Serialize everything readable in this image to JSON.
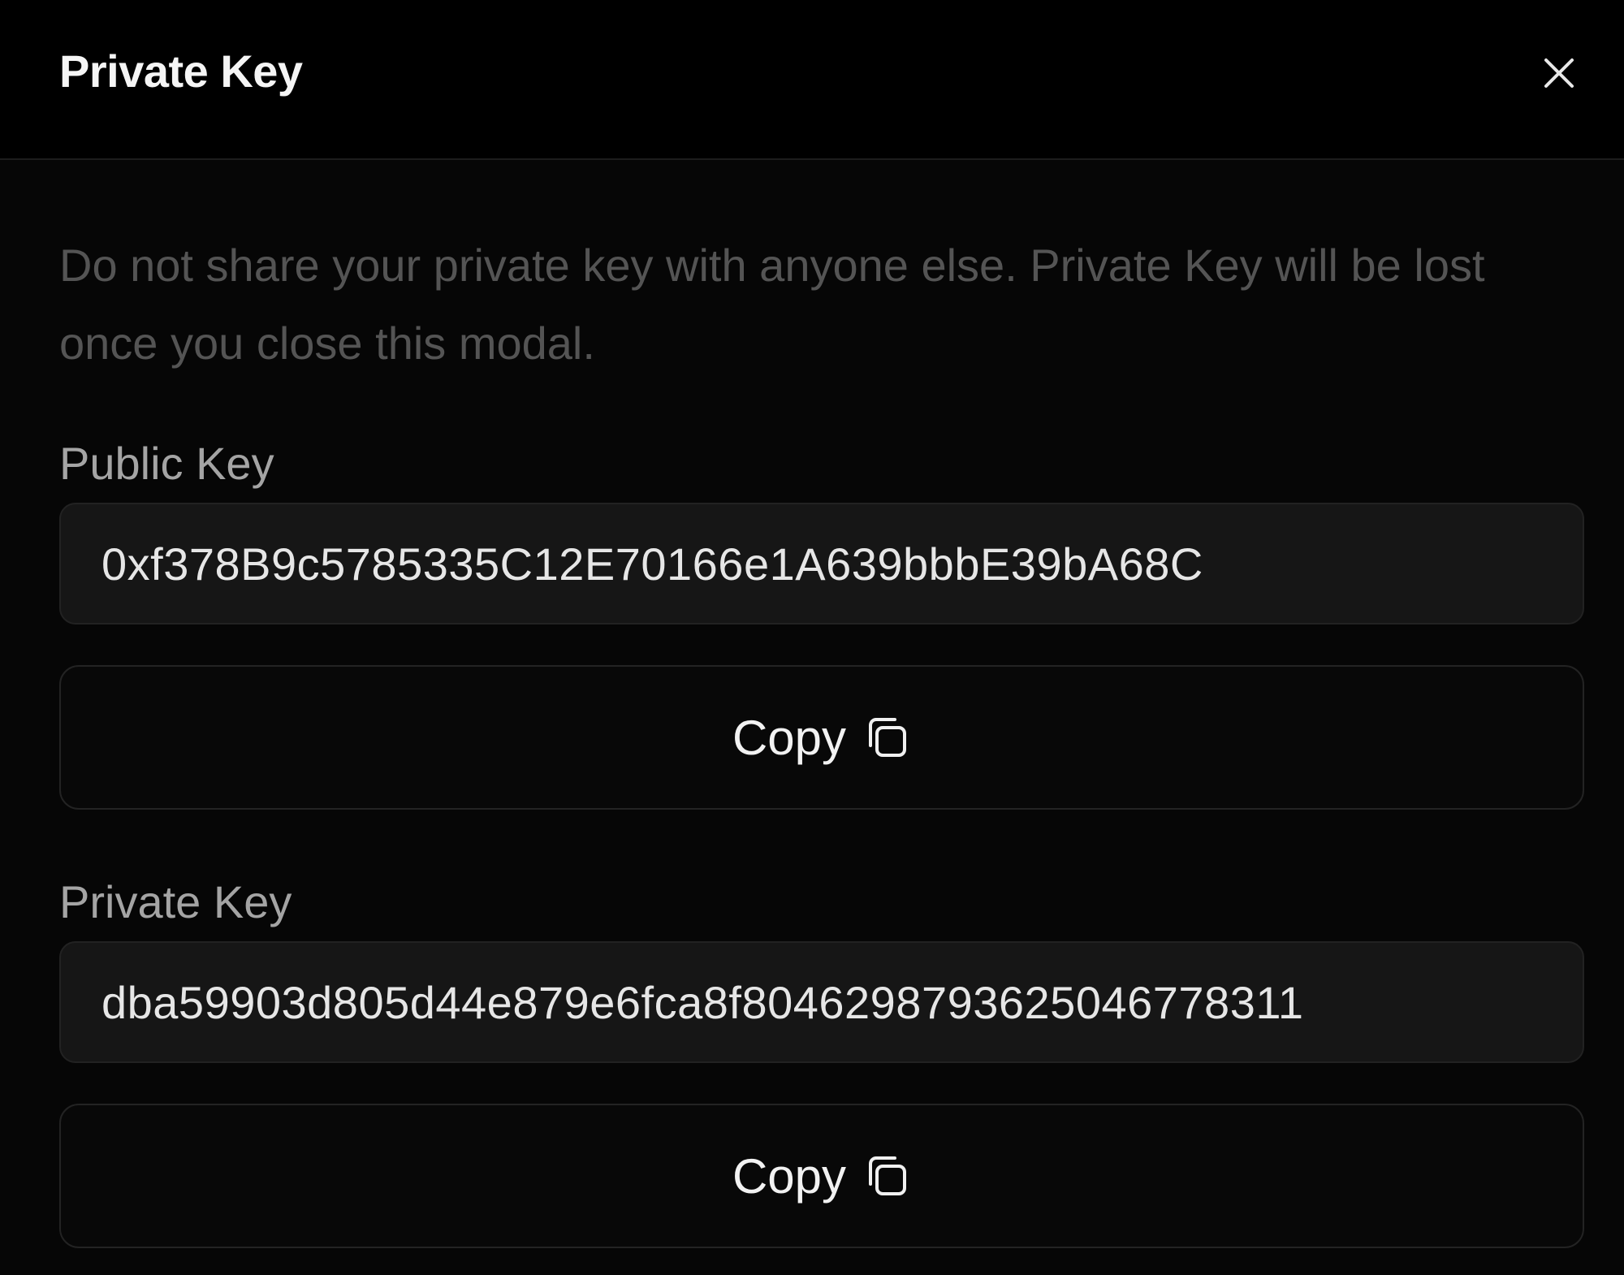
{
  "modal": {
    "title": "Private Key",
    "close_icon": "close-icon",
    "warning": "Do not share your private key with anyone else. Private Key will be lost once you close this modal."
  },
  "public_key": {
    "label": "Public Key",
    "value": "0xf378B9c5785335C12E70166e1A639bbbE39bA68C",
    "copy_label": "Copy",
    "copy_icon": "copy-icon"
  },
  "private_key": {
    "label": "Private Key",
    "value": "dba59903d805d44e879e6fca8f8046298793625046778311",
    "copy_label": "Copy",
    "copy_icon": "copy-icon"
  }
}
